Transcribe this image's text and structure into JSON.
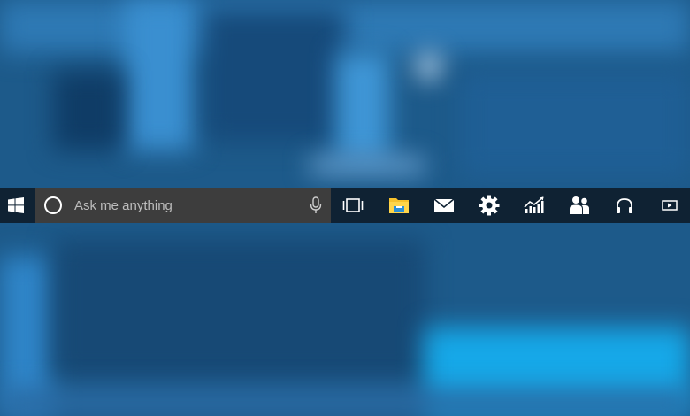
{
  "taskbar": {
    "search": {
      "placeholder": "Ask me anything"
    },
    "icons": [
      {
        "name": "task-view-icon"
      },
      {
        "name": "file-explorer-icon"
      },
      {
        "name": "mail-icon"
      },
      {
        "name": "settings-gear-icon"
      },
      {
        "name": "stock-chart-icon"
      },
      {
        "name": "people-icon"
      },
      {
        "name": "headphones-icon"
      },
      {
        "name": "movies-tv-icon"
      }
    ]
  },
  "colors": {
    "taskbar_bg": "#0f2233",
    "search_bg": "#3d3d3d",
    "folder_yellow": "#f7c22c",
    "folder_blue": "#2b8fd6"
  }
}
